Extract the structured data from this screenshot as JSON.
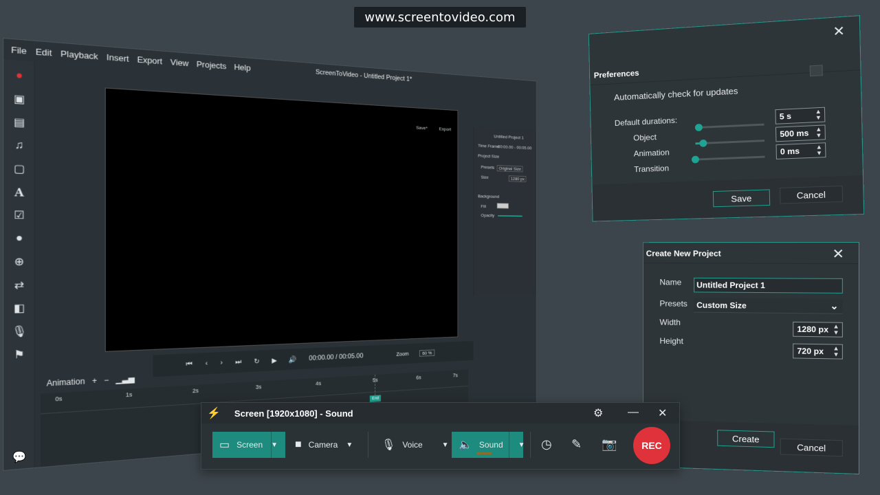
{
  "banner": {
    "url": "www.screentovideo.com"
  },
  "editor": {
    "menu": [
      "File",
      "Edit",
      "Playback",
      "Insert",
      "Export",
      "View",
      "Projects",
      "Help"
    ],
    "window_title": "ScreenToVideo - Untitled Project 1*",
    "top_actions": {
      "save": "Save*",
      "export": "Export"
    },
    "side_panel": {
      "project_name": "Untitled Project 1",
      "time_frame_label": "Time Frame",
      "time_frame_value": "00:00.00 - 00:05.00",
      "project_size_header": "Project Size",
      "presets_label": "Presets",
      "presets_value": "Original Size",
      "size_label": "Size",
      "size_value": "1280 px",
      "background_header": "Background",
      "fill_label": "Fill",
      "opacity_label": "Opacity"
    },
    "transport": {
      "time": "00:00.00 / 00:05.00",
      "zoom_label": "Zoom",
      "zoom_value": "60 %"
    },
    "animation_label": "Animation",
    "timeline": {
      "ticks": [
        "0s",
        "1s",
        "2s",
        "3s",
        "4s",
        "5s",
        "6s",
        "7s"
      ],
      "end_label": "End"
    }
  },
  "preferences": {
    "title": "Preferences",
    "auto_update_label": "Automatically check for updates",
    "auto_update_checked": false,
    "default_durations_label": "Default durations:",
    "rows": [
      {
        "label": "Object",
        "value": "5 s",
        "level": 0.05
      },
      {
        "label": "Animation",
        "value": "500 ms",
        "level": 0.1
      },
      {
        "label": "Transition",
        "value": "0 ms",
        "level": 0.0
      }
    ],
    "save_label": "Save",
    "cancel_label": "Cancel"
  },
  "create_project": {
    "title": "Create New Project",
    "name_label": "Name",
    "name_value": "Untitled Project 1",
    "presets_label": "Presets",
    "presets_value": "Custom Size",
    "width_label": "Width",
    "width_value": "1280 px",
    "height_label": "Height",
    "height_value": "720 px",
    "create_label": "Create",
    "cancel_label": "Cancel"
  },
  "recorder": {
    "title": "Screen [1920x1080] - Sound",
    "screen_label": "Screen",
    "camera_label": "Camera",
    "voice_label": "Voice",
    "sound_label": "Sound",
    "rec_label": "REC"
  },
  "colors": {
    "accent": "#1fa392",
    "rec": "#e0323a",
    "background": "#3c454b"
  }
}
